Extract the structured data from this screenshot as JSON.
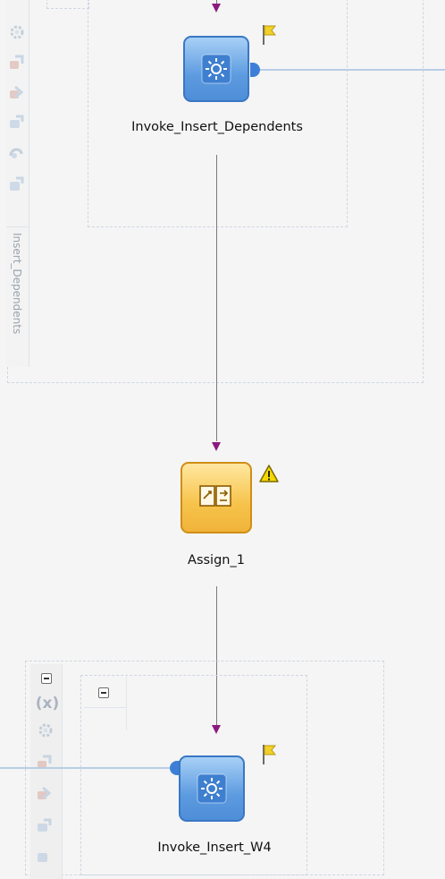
{
  "nodes": {
    "invoke_top": {
      "label": "Invoke_Insert_Dependents",
      "type": "invoke",
      "badge": "flag"
    },
    "assign": {
      "label": "Assign_1",
      "type": "assign",
      "badge": "warning"
    },
    "invoke_bottom": {
      "label": "Invoke_Insert_W4",
      "type": "invoke",
      "badge": "flag"
    }
  },
  "scope_top": {
    "side_label": "Insert_Dependents"
  },
  "scope_bottom": {
    "variable_icon_text": "(x)"
  },
  "colors": {
    "invoke_fill": "#5d9be0",
    "invoke_border": "#3a77c4",
    "assign_fill": "#f6c34a",
    "assign_border": "#d08e17",
    "arrow": "#8b1a7e",
    "flow_line": "#7a7a7a",
    "partner_link": "#b9cde6",
    "flag": "#f2d02a",
    "warning": "#f5d800"
  }
}
